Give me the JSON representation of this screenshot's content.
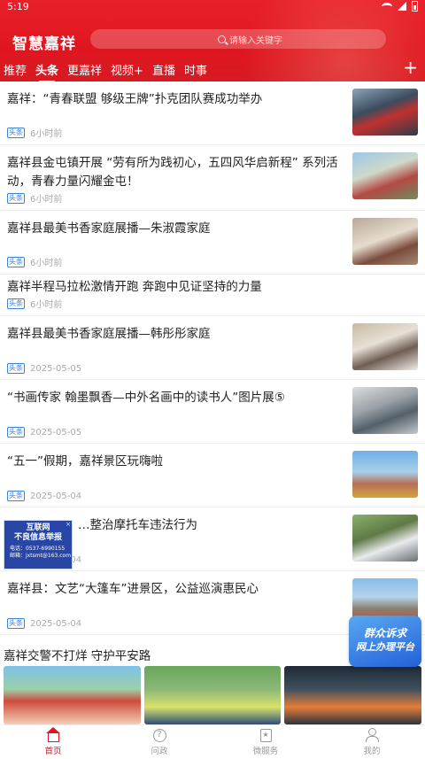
{
  "status_bar": {
    "time": "5:19"
  },
  "header": {
    "app_title": "智慧嘉祥",
    "search_placeholder": "请输入关键字",
    "tabs": [
      {
        "label": "推荐"
      },
      {
        "label": "头条",
        "active": true
      },
      {
        "label": "更嘉祥"
      },
      {
        "label": "视频+"
      },
      {
        "label": "直播"
      },
      {
        "label": "时事"
      }
    ],
    "add_label": "+"
  },
  "news": [
    {
      "title": "嘉祥：“青春联盟 够级王牌”扑克团队赛成功举办",
      "tag": "头条",
      "time": "6小时前"
    },
    {
      "title": "嘉祥县金屯镇开展 “劳有所为践初心，五四风华启新程” 系列活动，青春力量闪耀金屯！",
      "tag": "头条",
      "time": "6小时前"
    },
    {
      "title": "嘉祥县最美书香家庭展播—朱淑霞家庭",
      "tag": "头条",
      "time": "6小时前"
    },
    {
      "title": "嘉祥半程马拉松激情开跑 奔跑中见证坚持的力量",
      "tag": "头条",
      "time": "6小时前"
    },
    {
      "title": "嘉祥县最美书香家庭展播—韩彤彤家庭",
      "tag": "头条",
      "time": "2025-05-05"
    },
    {
      "title": "“书画传家 翰墨飘香—中外名画中的读书人”图片展⑤",
      "tag": "头条",
      "time": "2025-05-05"
    },
    {
      "title": "“五一”假期，嘉祥景区玩嗨啦",
      "tag": "头条",
      "time": "2025-05-04"
    },
    {
      "title": "…整治摩托车违法行为",
      "tag": "头条",
      "time": "2025-05-04"
    },
    {
      "title": "嘉祥县：文艺“大篷车”进景区，公益巡演惠民心",
      "tag": "头条",
      "time": "2025-05-04"
    }
  ],
  "ad_left": {
    "line1": "互联网",
    "line2": "不良信息举报",
    "phone": "电话：0537-6990155",
    "email": "邮箱：jxtsmt@163.com",
    "close": "×"
  },
  "ad_right": {
    "line1": "群众诉求",
    "line2": "网上办理平台"
  },
  "feature": {
    "title": "嘉祥交警不打烊 守护平安路"
  },
  "bottom_nav": [
    {
      "label": "首页",
      "icon": "home-icon",
      "active": true
    },
    {
      "label": "问政",
      "icon": "question-icon"
    },
    {
      "label": "微服务",
      "icon": "service-icon"
    },
    {
      "label": "我的",
      "icon": "user-icon"
    }
  ]
}
